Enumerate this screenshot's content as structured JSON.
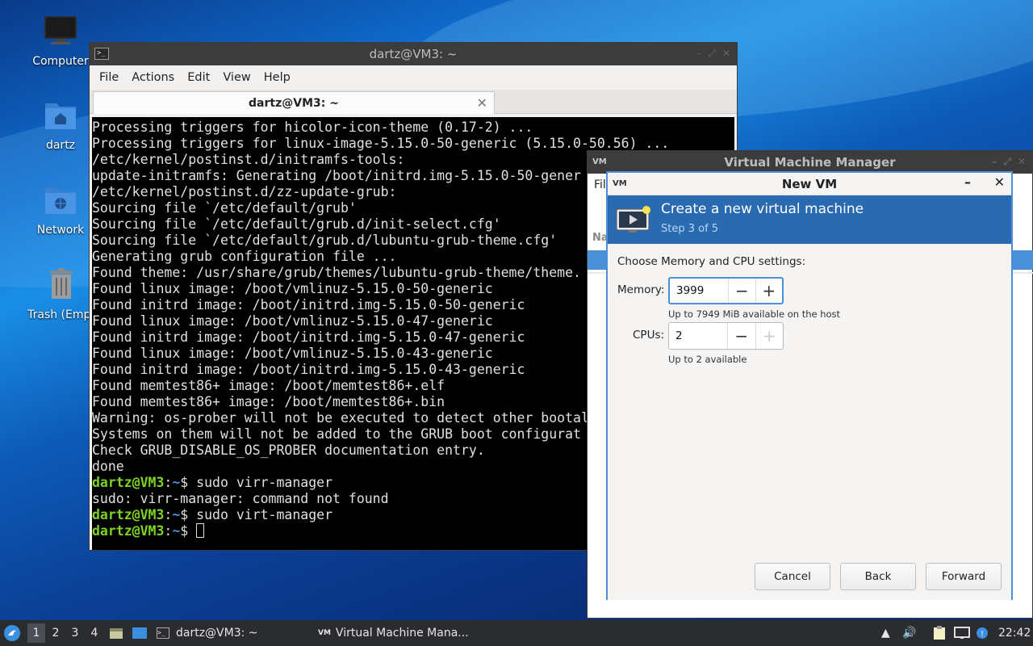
{
  "desktop": {
    "icons": [
      {
        "label": "Computer"
      },
      {
        "label": "dartz"
      },
      {
        "label": "Network"
      },
      {
        "label": "Trash (Empt"
      }
    ]
  },
  "terminal": {
    "title": "dartz@VM3: ~",
    "menu": [
      "File",
      "Actions",
      "Edit",
      "View",
      "Help"
    ],
    "tab_label": "dartz@VM3: ~",
    "lines": [
      "Processing triggers for hicolor-icon-theme (0.17-2) ...",
      "Processing triggers for linux-image-5.15.0-50-generic (5.15.0-50.56) ...",
      "/etc/kernel/postinst.d/initramfs-tools:",
      "update-initramfs: Generating /boot/initrd.img-5.15.0-50-gener",
      "/etc/kernel/postinst.d/zz-update-grub:",
      "Sourcing file `/etc/default/grub'",
      "Sourcing file `/etc/default/grub.d/init-select.cfg'",
      "Sourcing file `/etc/default/grub.d/lubuntu-grub-theme.cfg'",
      "Generating grub configuration file ...",
      "Found theme: /usr/share/grub/themes/lubuntu-grub-theme/theme.",
      "Found linux image: /boot/vmlinuz-5.15.0-50-generic",
      "Found initrd image: /boot/initrd.img-5.15.0-50-generic",
      "Found linux image: /boot/vmlinuz-5.15.0-47-generic",
      "Found initrd image: /boot/initrd.img-5.15.0-47-generic",
      "Found linux image: /boot/vmlinuz-5.15.0-43-generic",
      "Found initrd image: /boot/initrd.img-5.15.0-43-generic",
      "Found memtest86+ image: /boot/memtest86+.elf",
      "Found memtest86+ image: /boot/memtest86+.bin",
      "Warning: os-prober will not be executed to detect other bootal",
      "Systems on them will not be added to the GRUB boot configurat",
      "Check GRUB_DISABLE_OS_PROBER documentation entry.",
      "done"
    ],
    "prompt_user": "dartz@VM3",
    "prompt_sep": ":",
    "prompt_path": "~",
    "prompt_dollar": "$ ",
    "cmd1": "sudo virr-manager",
    "error_line": "sudo: virr-manager: command not found",
    "cmd2": "sudo virt-manager"
  },
  "vmm": {
    "title": "Virtual Machine Manager",
    "menu_partial": "Fil",
    "col_partial": "Na"
  },
  "dialog": {
    "title": "New VM",
    "header_title": "Create a new virtual machine",
    "step": "Step 3 of 5",
    "prompt": "Choose Memory and CPU settings:",
    "memory_label": "Memory:",
    "memory_value": "3999",
    "memory_hint": "Up to 7949 MiB available on the host",
    "cpus_label": "CPUs:",
    "cpus_value": "2",
    "cpus_hint": "Up to 2 available",
    "cancel": "Cancel",
    "back": "Back",
    "forward": "Forward"
  },
  "taskbar": {
    "workspaces": [
      "1",
      "2",
      "3",
      "4"
    ],
    "active_workspace": "1",
    "tasks": [
      {
        "label": "dartz@VM3: ~"
      },
      {
        "label": "Virtual Machine Mana..."
      }
    ],
    "clock": "22:42"
  }
}
